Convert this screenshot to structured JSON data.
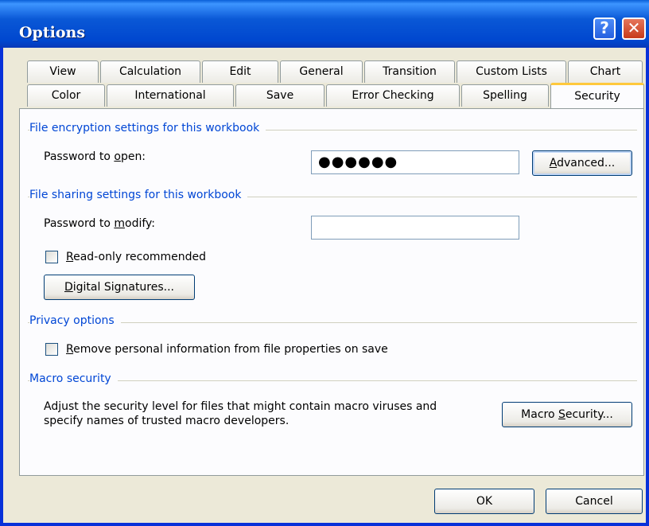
{
  "window": {
    "title": "Options"
  },
  "titlebar": {
    "help_glyph": "?",
    "close_glyph": "✕"
  },
  "tabs": {
    "row1": [
      "View",
      "Calculation",
      "Edit",
      "General",
      "Transition",
      "Custom Lists",
      "Chart"
    ],
    "row2": [
      "Color",
      "International",
      "Save",
      "Error Checking",
      "Spelling",
      "Security"
    ],
    "active": "Security"
  },
  "encryption": {
    "section_title": "File encryption settings for this workbook",
    "password_label_pre": "Password to ",
    "password_label_key": "o",
    "password_label_post": "pen:",
    "password_value": "●●●●●●",
    "advanced_pre": "",
    "advanced_key": "A",
    "advanced_post": "dvanced..."
  },
  "sharing": {
    "section_title": "File sharing settings for this workbook",
    "modify_label_pre": "Password to ",
    "modify_label_key": "m",
    "modify_label_post": "odify:",
    "modify_value": "",
    "readonly_pre": "",
    "readonly_key": "R",
    "readonly_post": "ead-only recommended",
    "readonly_checked": false,
    "digsig_pre": "",
    "digsig_key": "D",
    "digsig_post": "igital Signatures..."
  },
  "privacy": {
    "section_title": "Privacy options",
    "remove_pre": "",
    "remove_key": "R",
    "remove_post": "emove personal information from file properties on save",
    "remove_checked": false
  },
  "macro": {
    "section_title": "Macro security",
    "desc_line1": "Adjust the security level for files that might contain macro viruses and",
    "desc_line2": "specify names of trusted macro developers.",
    "button_pre": "Macro ",
    "button_key": "S",
    "button_post": "ecurity..."
  },
  "footer": {
    "ok": "OK",
    "cancel": "Cancel"
  },
  "colors": {
    "accent": "#0046d5",
    "titlebar": "#0054e3",
    "close": "#c73a1a",
    "tab_highlight": "#ffc83c"
  }
}
